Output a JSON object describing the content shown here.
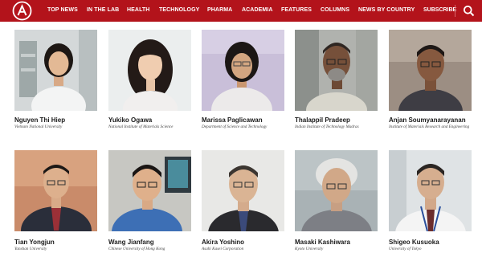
{
  "nav": {
    "items": [
      "TOP NEWS",
      "IN THE LAB",
      "HEALTH",
      "TECHNOLOGY",
      "PHARMA",
      "ACADEMIA",
      "FEATURES",
      "COLUMNS",
      "NEWS BY COUNTRY"
    ],
    "subscribe": "SUBSCRIBE",
    "icons": {
      "logo": "brand-logo-icon",
      "search": "search-icon"
    },
    "color": "#b3131b"
  },
  "people": [
    {
      "name": "Nguyen Thi Hiep",
      "affiliation": "Vietnam National University"
    },
    {
      "name": "Yukiko Ogawa",
      "affiliation": "National Institute of Materials Science"
    },
    {
      "name": "Marissa Paglicawan",
      "affiliation": "Department of Science and Technology"
    },
    {
      "name": "Thalappil Pradeep",
      "affiliation": "Indian Institute of Technology Madras"
    },
    {
      "name": "Anjan Soumyanarayanan",
      "affiliation": "Institute of Materials Research and Engineering"
    },
    {
      "name": "Tian Yongjun",
      "affiliation": "Yanshan University"
    },
    {
      "name": "Wang Jianfang",
      "affiliation": "Chinese University of Hong Kong"
    },
    {
      "name": "Akira Yoshino",
      "affiliation": "Asahi Kasei Corporation"
    },
    {
      "name": "Masaki Kashiwara",
      "affiliation": "Kyoto University"
    },
    {
      "name": "Shigeo Kusuoka",
      "affiliation": "University of Tokyo"
    }
  ]
}
